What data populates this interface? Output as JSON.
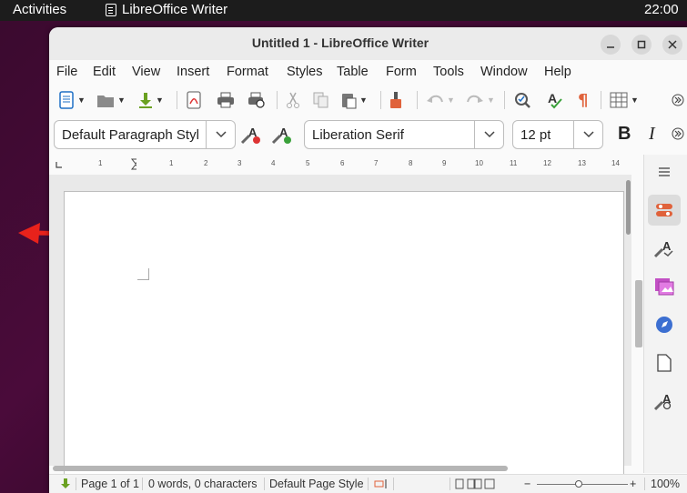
{
  "topbar": {
    "activities": "Activities",
    "app_name": "LibreOffice Writer",
    "clock": "22:00"
  },
  "window": {
    "title": "Untitled 1 - LibreOffice Writer"
  },
  "menu": [
    "File",
    "Edit",
    "View",
    "Insert",
    "Format",
    "Styles",
    "Table",
    "Form",
    "Tools",
    "Window",
    "Help"
  ],
  "format": {
    "paragraph_style": "Default Paragraph Styl",
    "font_name": "Liberation Serif",
    "font_size": "12 pt",
    "bold": "B",
    "italic": "I"
  },
  "ruler": [
    "1",
    "1",
    "2",
    "3",
    "4",
    "5",
    "6",
    "7",
    "8",
    "9",
    "10",
    "11",
    "12",
    "13",
    "14"
  ],
  "status": {
    "page": "Page 1 of 1",
    "words": "0 words, 0 characters",
    "page_style": "Default Page Style",
    "zoom": "100%",
    "zoom_minus": "−",
    "zoom_plus": "+"
  },
  "colors": {
    "accent_red": "#e8221b",
    "topbar": "#1c1c1c",
    "desktop": "#3a0a2e"
  }
}
